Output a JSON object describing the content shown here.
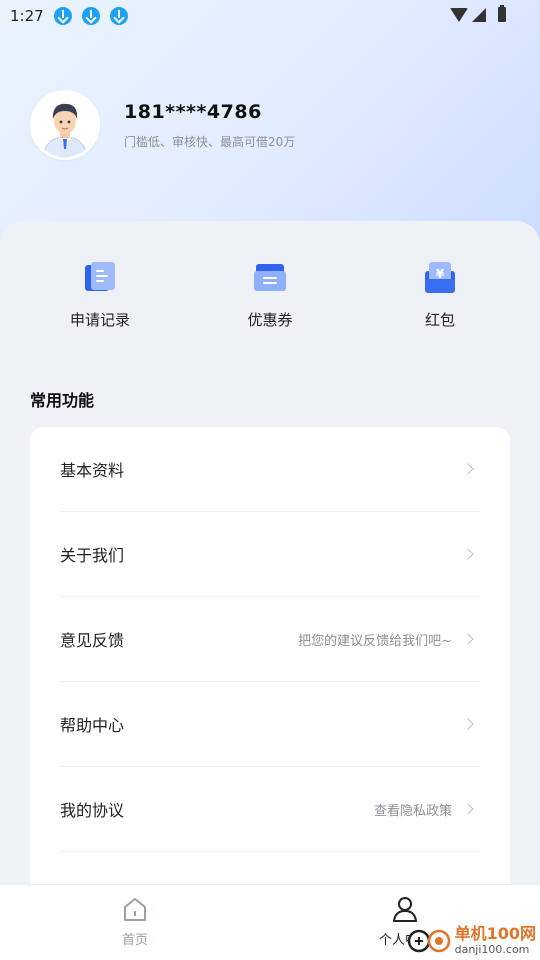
{
  "status_bar": {
    "time": "1:27",
    "notification_icons": [
      "download-icon",
      "download-icon",
      "download-icon"
    ]
  },
  "profile": {
    "phone": "181****4786",
    "tagline": "门槛低、审核快、最高可借20万"
  },
  "quick_actions": [
    {
      "label": "申请记录",
      "icon": "application-record-icon"
    },
    {
      "label": "优惠券",
      "icon": "coupon-icon"
    },
    {
      "label": "红包",
      "icon": "red-packet-icon"
    }
  ],
  "section": {
    "title": "常用功能"
  },
  "menu": [
    {
      "label": "基本资料",
      "hint": ""
    },
    {
      "label": "关于我们",
      "hint": ""
    },
    {
      "label": "意见反馈",
      "hint": "把您的建议反馈给我们吧~"
    },
    {
      "label": "帮助中心",
      "hint": ""
    },
    {
      "label": "我的协议",
      "hint": "查看隐私政策"
    }
  ],
  "tabbar": {
    "home_label": "首页",
    "profile_label": "个人中心"
  },
  "watermark": {
    "cn": "单机100网",
    "en": "danji100.com"
  },
  "colors": {
    "accent_blue": "#3b6cf6",
    "header_gradient": "#d6e3ff",
    "watermark_orange": "#e0752a"
  }
}
